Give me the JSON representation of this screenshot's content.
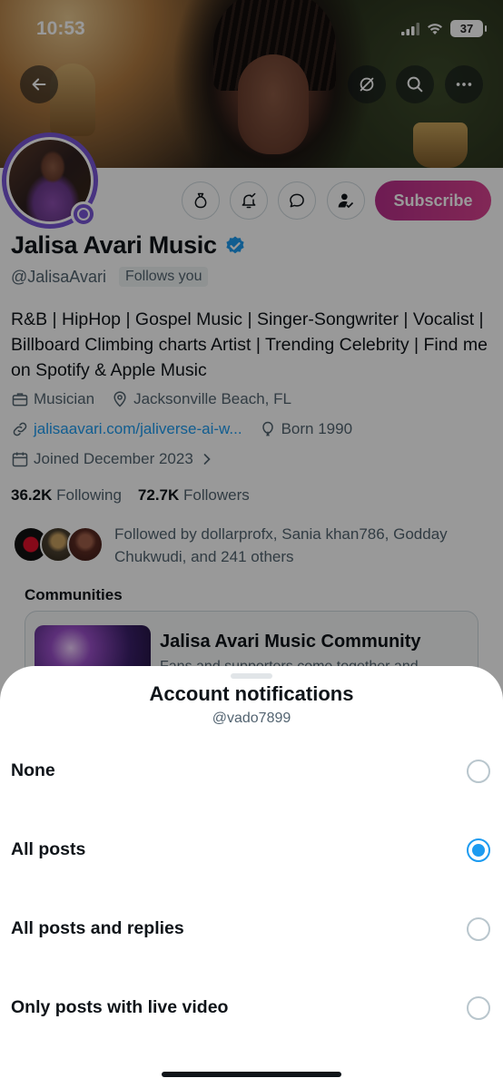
{
  "status_bar": {
    "time": "10:53",
    "battery": "37"
  },
  "profile": {
    "display_name": "Jalisa Avari Music",
    "handle": "@JalisaAvari",
    "follows_you": "Follows you",
    "subscribe_label": "Subscribe",
    "bio": "R&B | HipHop | Gospel Music | Singer-Songwriter | Vocalist | Billboard Climbing charts Artist | Trending Celebrity | Find me on Spotify & Apple Music",
    "profession": "Musician",
    "location": "Jacksonville Beach, FL",
    "website": "jalisaavari.com/jaliverse-ai-w...",
    "birth": "Born 1990",
    "joined": "Joined December 2023",
    "following_count": "36.2K",
    "following_label": "Following",
    "followers_count": "72.7K",
    "followers_label": "Followers",
    "followed_by": "Followed by dollarprofx, Sania khan786, Godday Chukwudi, and 241 others"
  },
  "communities": {
    "title": "Communities",
    "card_name": "Jalisa Avari Music Community",
    "card_desc": "Fans and supporters come together and"
  },
  "sheet": {
    "title": "Account notifications",
    "subtitle": "@vado7899",
    "options": [
      {
        "label": "None",
        "selected": false
      },
      {
        "label": "All posts",
        "selected": true
      },
      {
        "label": "All posts and replies",
        "selected": false
      },
      {
        "label": "Only posts with live video",
        "selected": false
      }
    ]
  },
  "colors": {
    "accent": "#1d9bf0",
    "subscribe": "#c9358c",
    "avatar_ring": "#7856d8"
  }
}
